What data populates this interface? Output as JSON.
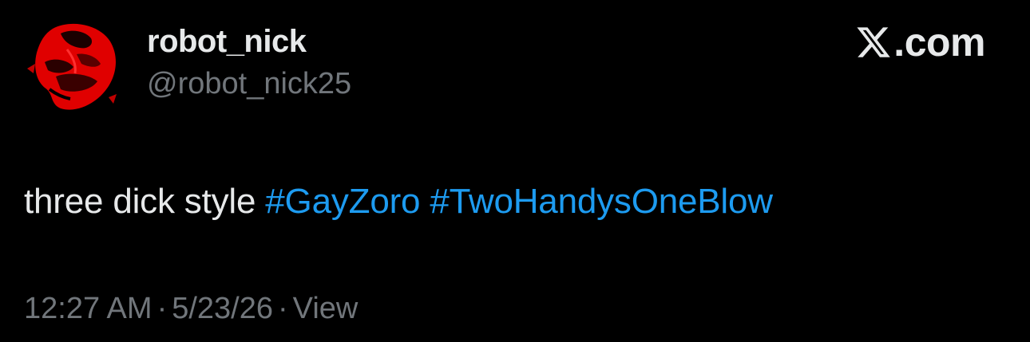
{
  "author": {
    "display_name": "robot_nick",
    "handle": "@robot_nick25"
  },
  "brand": {
    "icon": "x-logo-icon",
    "suffix": ".com"
  },
  "tweet": {
    "text_prefix": "three dick style ",
    "hashtags": [
      "#GayZoro",
      "#TwoHandysOneBlow"
    ]
  },
  "meta": {
    "time": "12:27 AM",
    "date": "5/23/26",
    "view_label": "View",
    "separator": "·"
  },
  "colors": {
    "background": "#000000",
    "primary_text": "#e7e9ea",
    "secondary_text": "#71767b",
    "link": "#1d9bf0",
    "avatar_accent": "#e00000"
  }
}
